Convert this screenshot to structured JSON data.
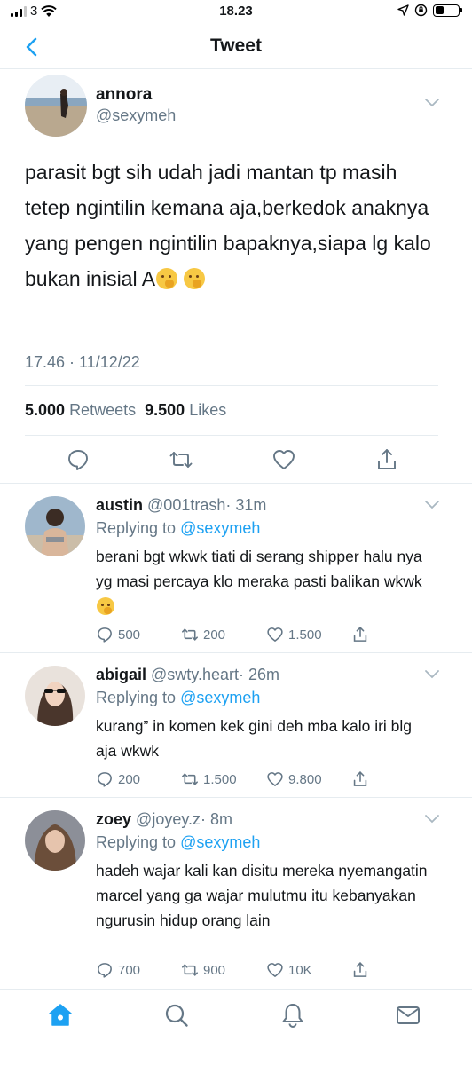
{
  "status_bar": {
    "carrier": "3",
    "time": "18.23"
  },
  "header": {
    "title": "Tweet"
  },
  "colors": {
    "accent": "#1da1f2",
    "secondary_text": "#657786",
    "divider": "#e6ecf0"
  },
  "main_tweet": {
    "name": "annora",
    "handle": "@sexymeh",
    "text": "parasit bgt sih udah jadi mantan tp masih tetep ngintilin kemana aja,berkedok anaknya yang pengen ngintilin bapaknya,siapa lg kalo bukan inisial A",
    "emojis": [
      "face-with-hand-over-mouth-emoji",
      "face-with-hand-over-mouth-emoji"
    ],
    "timestamp": "17.46 · 11/12/22",
    "retweets_count": "5.000",
    "retweets_label": "Retweets",
    "likes_count": "9.500",
    "likes_label": "Likes",
    "actions": [
      "reply-icon",
      "retweet-icon",
      "like-icon",
      "share-icon"
    ]
  },
  "replies": [
    {
      "name": "austin",
      "handle": "@001trash",
      "time": "· 31m",
      "replying_prefix": "Replying to",
      "replying_to": "@sexymeh",
      "text": "berani bgt wkwk tiati di serang shipper halu nya yg masi percaya klo meraka pasti balikan wkwk",
      "reply_count": "500",
      "retweet_count": "200",
      "like_count": "1.500"
    },
    {
      "name": "abigail",
      "handle": "@swty.heart",
      "time": "· 26m",
      "replying_prefix": "Replying to",
      "replying_to": "@sexymeh",
      "text": "kurang” in komen kek gini deh mba kalo iri blg aja wkwk",
      "reply_count": "200",
      "retweet_count": "1.500",
      "like_count": "9.800"
    },
    {
      "name": "zoey",
      "handle": "@joyey.z",
      "time": "· 8m",
      "replying_prefix": "Replying to",
      "replying_to": "@sexymeh",
      "text": "hadeh wajar kali kan disitu mereka nyemangatin marcel yang ga wajar mulutmu itu kebanyakan ngurusin hidup orang lain",
      "reply_count": "700",
      "retweet_count": "900",
      "like_count": "10K"
    }
  ],
  "tab_bar": [
    "home-icon",
    "search-icon",
    "notifications-icon",
    "messages-icon"
  ]
}
